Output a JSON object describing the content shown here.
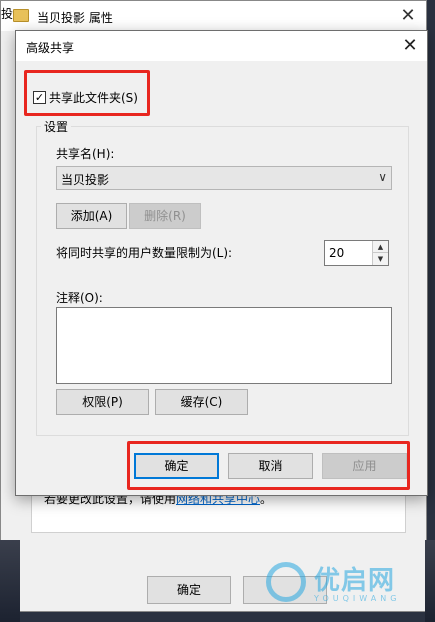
{
  "background_window": {
    "title": "当贝投影 属性",
    "tab_fragment": "投",
    "hint_prefix": "若要更改此设置，请使用",
    "hint_link": "网络和共享中心",
    "hint_suffix": "。",
    "ok_label": "确定",
    "close_glyph": "✕"
  },
  "dialog": {
    "title": "高级共享",
    "close_glyph": "✕",
    "share_checkbox_label": "共享此文件夹(S)",
    "share_checked": true,
    "settings_group_label": "设置",
    "share_name_label": "共享名(H):",
    "share_name_value": "当贝投影",
    "dropdown_glyph": "∨",
    "add_button": "添加(A)",
    "remove_button": "删除(R)",
    "user_limit_label": "将同时共享的用户数量限制为(L):",
    "user_limit_value": "20",
    "spin_up_glyph": "▲",
    "spin_down_glyph": "▼",
    "comment_label": "注释(O):",
    "comment_value": "",
    "permissions_button": "权限(P)",
    "caching_button": "缓存(C)",
    "ok_button": "确定",
    "cancel_button": "取消",
    "apply_button": "应用"
  },
  "watermark": {
    "text": "优启网",
    "subtext": "YOUQIWANG"
  },
  "colors": {
    "highlight_box": "#e8261f",
    "default_button_border": "#0078d7",
    "link": "#0066cc"
  }
}
